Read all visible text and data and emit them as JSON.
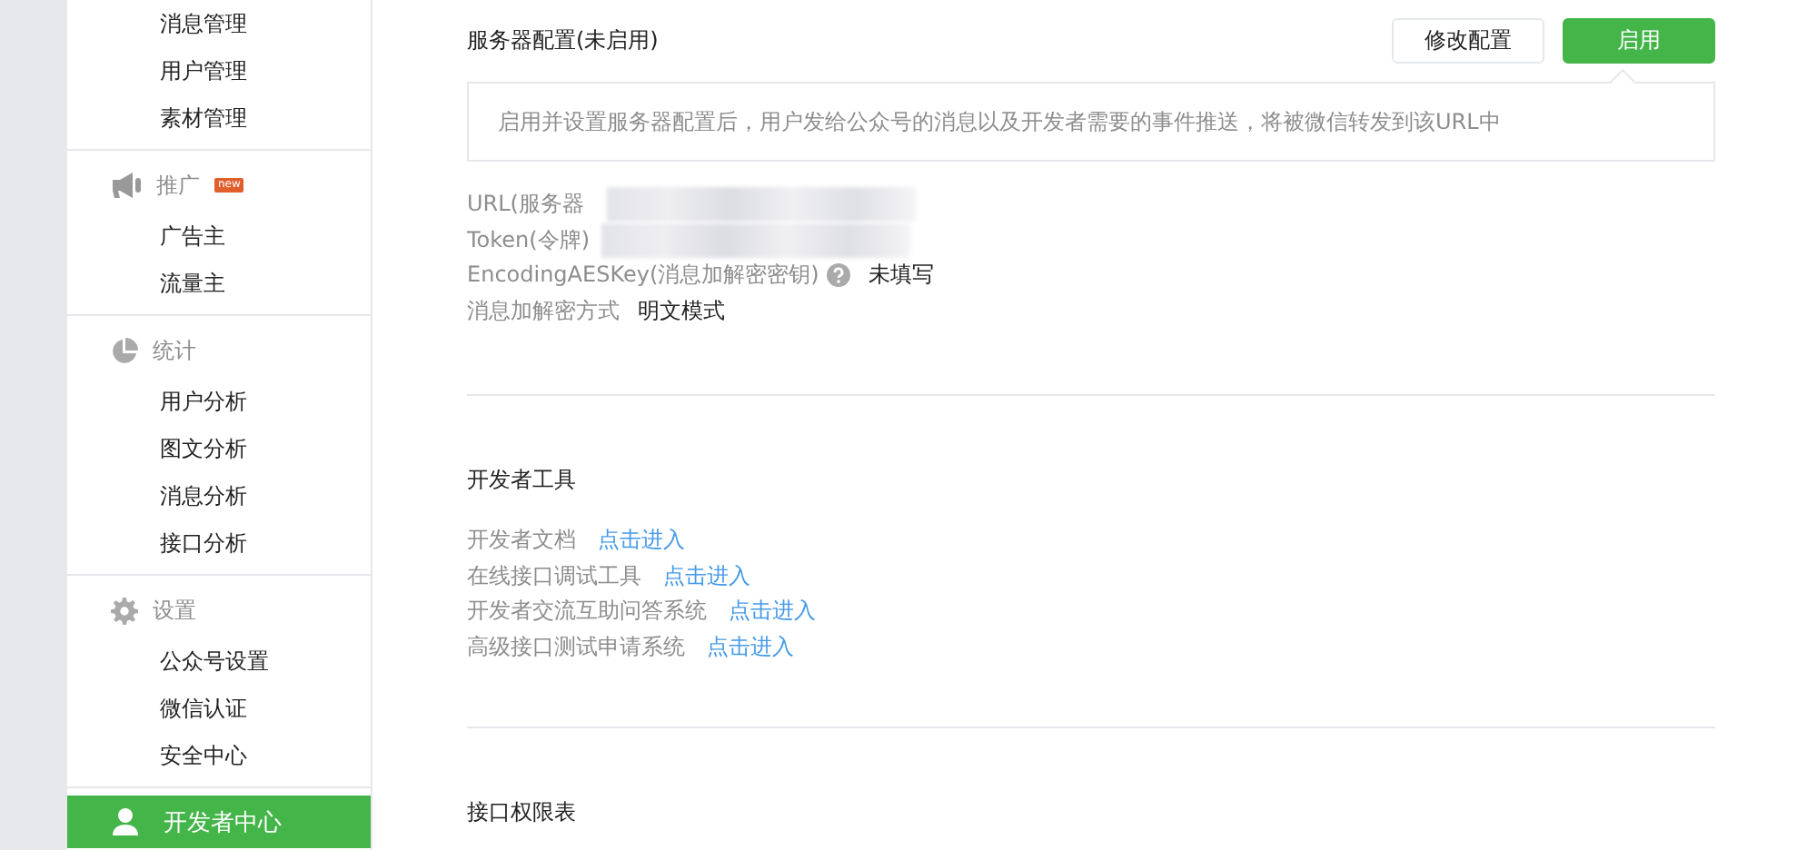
{
  "sidebar": {
    "groups": [
      {
        "items": [
          {
            "label": "消息管理",
            "selected": false
          },
          {
            "label": "用户管理",
            "selected": false
          },
          {
            "label": "素材管理",
            "selected": false
          }
        ]
      },
      {
        "title": "推广",
        "badge": "new",
        "items": [
          {
            "label": "广告主",
            "selected": false
          },
          {
            "label": "流量主",
            "selected": false
          }
        ]
      },
      {
        "title": "统计",
        "items": [
          {
            "label": "用户分析",
            "selected": false
          },
          {
            "label": "图文分析",
            "selected": false
          },
          {
            "label": "消息分析",
            "selected": false
          },
          {
            "label": "接口分析",
            "selected": false
          }
        ]
      },
      {
        "title": "设置",
        "items": [
          {
            "label": "公众号设置",
            "selected": false
          },
          {
            "label": "微信认证",
            "selected": false
          },
          {
            "label": "安全中心",
            "selected": false
          }
        ]
      }
    ],
    "active": {
      "label": "开发者中心",
      "selected": true
    }
  },
  "server_config": {
    "title": "服务器配置(未启用)",
    "buttons": [
      {
        "label": "修改配置",
        "kind": "default"
      },
      {
        "label": "启用",
        "kind": "primary"
      }
    ],
    "notice": "启用并设置服务器配置后，用户发给公众号的消息以及开发者需要的事件推送，将被微信转发到该URL中",
    "fields": [
      {
        "label": "URL(服务器",
        "kind": "masked",
        "help": false
      },
      {
        "label": "Token(令牌)",
        "kind": "masked",
        "help": false
      },
      {
        "label": "EncodingAESKey(消息加解密密钥)",
        "kind": "text",
        "value": "未填写",
        "help": true
      },
      {
        "label": "消息加解密方式",
        "kind": "text",
        "value": "明文模式",
        "help": false
      }
    ]
  },
  "developer_tools": {
    "title": "开发者工具",
    "items": [
      {
        "label": "开发者文档",
        "link": "点击进入"
      },
      {
        "label": "在线接口调试工具",
        "link": "点击进入"
      },
      {
        "label": "开发者交流互助问答系统",
        "link": "点击进入"
      },
      {
        "label": "高级接口测试申请系统",
        "link": "点击进入"
      }
    ]
  },
  "permissions": {
    "title": "接口权限表"
  }
}
